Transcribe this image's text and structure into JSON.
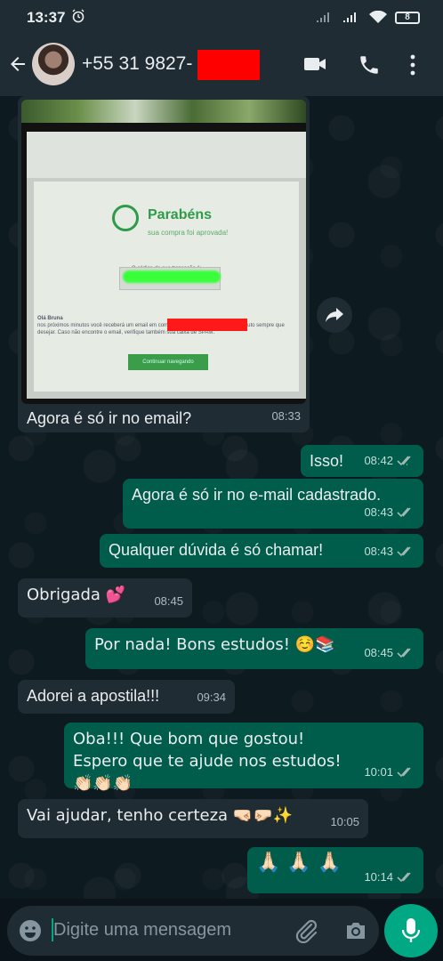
{
  "status": {
    "time": "13:37",
    "battery": "8"
  },
  "header": {
    "contact": "+55 31 9827-"
  },
  "image_message": {
    "caption": "Agora é só ir no email?",
    "time": "08:33",
    "photo": {
      "title": "Parabéns",
      "subtitle": "sua compra foi aprovada!",
      "code_label": "O código da sua transação é:",
      "greeting": "Olá Bruna",
      "body": "nos próximos minutos você receberá um email em                     com os dados para acessar este produto sempre que desejar. Caso não encontre o email, verifique também sua caixa de SPAM.",
      "button": "Continuar navegando"
    }
  },
  "messages": [
    {
      "text": "Isso!",
      "time": "08:42"
    },
    {
      "text": "Agora é só ir no e-mail cadastrado.",
      "time": "08:43"
    },
    {
      "text": "Qualquer dúvida é só chamar!",
      "time": "08:43"
    },
    {
      "text": "Obrigada 💕",
      "time": "08:45"
    },
    {
      "text": "Por nada! Bons estudos! ☺️📚",
      "time": "08:45"
    },
    {
      "text": "Adorei a apostila!!!",
      "time": "09:34"
    },
    {
      "text": "Oba!!! Que bom que gostou! Espero que te ajude nos estudos! 👏🏻👏🏻👏🏻",
      "time": "10:01"
    },
    {
      "text": "Vai ajudar, tenho certeza 🤜🏻🤛🏻✨",
      "time": "10:05"
    },
    {
      "text": "🙏🏻 🙏🏻 🙏🏻",
      "time": "10:14"
    }
  ],
  "input": {
    "placeholder": "Digite uma mensagem"
  },
  "colors": {
    "outgoing": "#005c4b",
    "incoming": "#202c33",
    "accent": "#00a884"
  }
}
